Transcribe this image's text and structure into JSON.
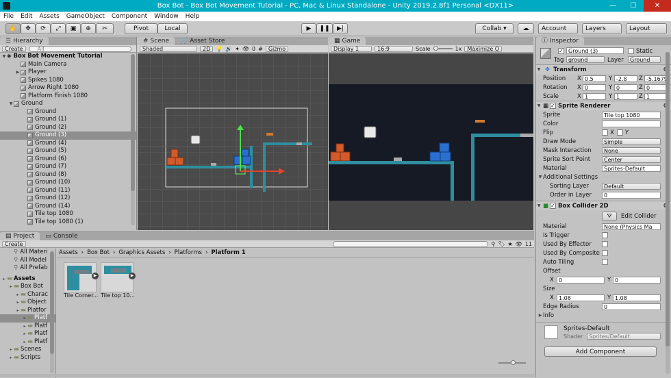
{
  "title": "Box Bot - Box Bot Movement Tutorial - PC, Mac & Linux Standalone - Unity 2019.2.8f1 Personal <DX11>",
  "window_buttons": {
    "minimize": "—",
    "maximize": "☐",
    "close": "✕"
  },
  "menu": [
    "File",
    "Edit",
    "Assets",
    "GameObject",
    "Component",
    "Window",
    "Help"
  ],
  "toolbar": {
    "pivot": "Pivot",
    "local": "Local",
    "collab": "Collab ▾",
    "account": "Account",
    "layers": "Layers",
    "layout": "Layout"
  },
  "hierarchy": {
    "tab": "Hierarchy",
    "create": "Create",
    "search_placeholder": "All",
    "scene": "Box Bot Movement Tutorial",
    "items": [
      {
        "label": "Main Camera",
        "indent": 2
      },
      {
        "label": "Player",
        "indent": 2,
        "arrow": true
      },
      {
        "label": "Spikes 1080",
        "indent": 2
      },
      {
        "label": "Arrow Right 1080",
        "indent": 2
      },
      {
        "label": "Platform Finish 1080",
        "indent": 2
      },
      {
        "label": "Ground",
        "indent": 1,
        "expanded": true
      },
      {
        "label": "Ground",
        "indent": 3
      },
      {
        "label": "Ground (1)",
        "indent": 3
      },
      {
        "label": "Ground (2)",
        "indent": 3
      },
      {
        "label": "Ground (3)",
        "indent": 3,
        "selected": true
      },
      {
        "label": "Ground (4)",
        "indent": 3
      },
      {
        "label": "Ground (5)",
        "indent": 3
      },
      {
        "label": "Ground (6)",
        "indent": 3
      },
      {
        "label": "Ground (7)",
        "indent": 3
      },
      {
        "label": "Ground (8)",
        "indent": 3
      },
      {
        "label": "Ground (10)",
        "indent": 3
      },
      {
        "label": "Ground (11)",
        "indent": 3
      },
      {
        "label": "Ground (12)",
        "indent": 3
      },
      {
        "label": "Ground (14)",
        "indent": 3
      },
      {
        "label": "Tile top 1080",
        "indent": 3
      },
      {
        "label": "Tile top 1080 (1)",
        "indent": 3
      }
    ]
  },
  "scene": {
    "tab": "Scene",
    "asset_store": "Asset Store",
    "shading": "Shaded",
    "mode_2d": "2D",
    "hidden_count": "0",
    "gizmos": "Gizmo"
  },
  "game": {
    "tab": "Game",
    "display": "Display 1",
    "aspect": "16:9",
    "scale_label": "Scale",
    "scale_value": "1x",
    "maximize": "Maximize O"
  },
  "project": {
    "tab": "Project",
    "console": "Console",
    "create": "Create",
    "favorites": [
      "All Materi",
      "All Model",
      "All Prefab"
    ],
    "tree": [
      {
        "label": "Assets",
        "indent": 0,
        "bold": true
      },
      {
        "label": "Box Bot",
        "indent": 1
      },
      {
        "label": "Charac",
        "indent": 2
      },
      {
        "label": "Object",
        "indent": 2
      },
      {
        "label": "Platfor",
        "indent": 2
      },
      {
        "label": "Platf",
        "indent": 3,
        "selected": true
      },
      {
        "label": "Platf",
        "indent": 3
      },
      {
        "label": "Platf",
        "indent": 3
      },
      {
        "label": "Platf",
        "indent": 3
      },
      {
        "label": "Scenes",
        "indent": 1
      },
      {
        "label": "Scripts",
        "indent": 1
      }
    ],
    "breadcrumb": [
      "Assets",
      "Box Bot",
      "Graphics Assets",
      "Platforms",
      "Platform 1"
    ],
    "assets": [
      "Tile Corner...",
      "Tile top 10..."
    ],
    "count": "11"
  },
  "inspector": {
    "tab": "Inspector",
    "object_name": "Ground (3)",
    "static": "Static",
    "tag_label": "Tag",
    "tag": "ground",
    "layer_label": "Layer",
    "layer": "Ground",
    "transform": {
      "title": "Transform",
      "position": "Position",
      "rotation": "Rotation",
      "scale": "Scale",
      "pos": [
        "0.5",
        "-2.8",
        "-5.1679"
      ],
      "rot": [
        "0",
        "0",
        "0"
      ],
      "scl": [
        "1",
        "1",
        "1"
      ],
      "axes": [
        "X",
        "Y",
        "Z"
      ]
    },
    "sprite_renderer": {
      "title": "Sprite Renderer",
      "sprite_label": "Sprite",
      "sprite": "Tile top 1080",
      "color_label": "Color",
      "flip_label": "Flip",
      "flip_x": "X",
      "flip_y": "Y",
      "draw_mode_label": "Draw Mode",
      "draw_mode": "Simple",
      "mask_label": "Mask Interaction",
      "mask": "None",
      "sort_point_label": "Sprite Sort Point",
      "sort_point": "Center",
      "material_label": "Material",
      "material": "Sprites-Default",
      "additional": "Additional Settings",
      "sorting_layer_label": "Sorting Layer",
      "sorting_layer": "Default",
      "order_label": "Order in Layer",
      "order": "0"
    },
    "box_collider": {
      "title": "Box Collider 2D",
      "edit": "Edit Collider",
      "material_label": "Material",
      "material": "None (Physics Ma",
      "trigger": "Is Trigger",
      "effector": "Used By Effector",
      "composite": "Used By Composite",
      "auto_tiling": "Auto Tiling",
      "offset_label": "Offset",
      "offset": [
        "0",
        "0"
      ],
      "size_label": "Size",
      "size": [
        "1.08",
        "1.08"
      ],
      "edge_label": "Edge Radius",
      "edge": "0",
      "info": "Info",
      "xy": [
        "X",
        "Y"
      ]
    },
    "material": {
      "name": "Sprites-Default",
      "shader_label": "Shader",
      "shader": "Sprites/Default"
    },
    "add_component": "Add Component"
  }
}
